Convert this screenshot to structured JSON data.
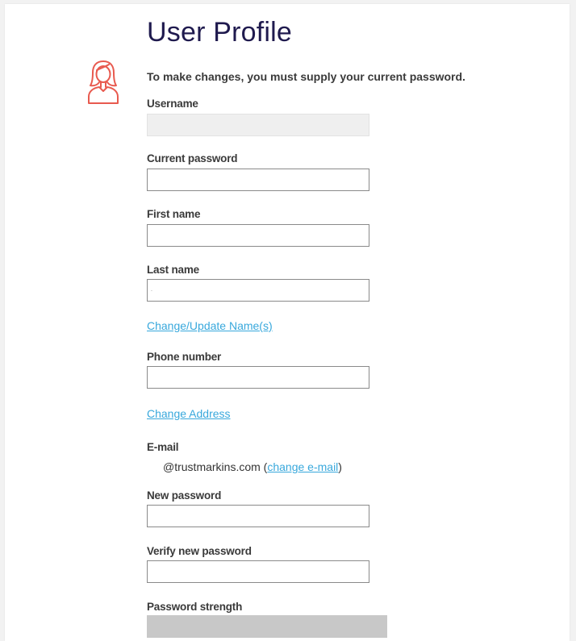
{
  "page": {
    "title": "User Profile",
    "notice": "To make changes, you must supply your current password."
  },
  "fields": {
    "username": {
      "label": "Username",
      "value": ""
    },
    "current_password": {
      "label": "Current password",
      "value": ""
    },
    "first_name": {
      "label": "First name",
      "value": ""
    },
    "last_name": {
      "label": "Last name",
      "value": "."
    },
    "phone_number": {
      "label": "Phone number",
      "value": ""
    },
    "new_password": {
      "label": "New password",
      "value": ""
    },
    "verify_new_password": {
      "label": "Verify new password",
      "value": ""
    }
  },
  "links": {
    "change_name": "Change/Update Name(s)",
    "change_address": "Change Address"
  },
  "email": {
    "label": "E-mail",
    "value": "@trustmarkins.com",
    "open_paren": " (",
    "change_link": "change e-mail",
    "close_paren": ")"
  },
  "password_strength": {
    "label": "Password strength",
    "fraction": 0
  },
  "icons": {
    "avatar": "user-avatar-icon"
  },
  "colors": {
    "title": "#1f1a4e",
    "link": "#38a8dc",
    "avatar": "#e85a4f",
    "strength_bar": "#c8c8c8"
  }
}
